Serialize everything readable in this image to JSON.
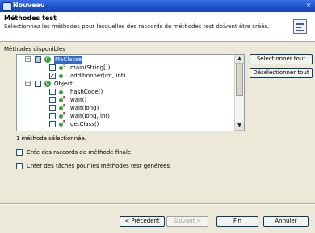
{
  "window": {
    "title": "Nouveau",
    "close_glyph": "×"
  },
  "header": {
    "title": "Méthodes test",
    "description": "Sélectionnez les méthodes pour lesquelles des raccords de méthodes test doivent être créés.",
    "icon": "wizard-page-icon"
  },
  "tree": {
    "label": "Méthodes disponibles",
    "rows": [
      {
        "label": "MaClasse",
        "checked": "partial",
        "selected": true,
        "icon": "class-icon"
      },
      {
        "label": "main(String[])",
        "checked": false,
        "icon": "method-icon",
        "modifier": "static"
      },
      {
        "label": "additionner(int, int)",
        "checked": true,
        "icon": "method-icon"
      },
      {
        "label": "Object",
        "checked": false,
        "icon": "class-icon"
      },
      {
        "label": "hashCode()",
        "checked": false,
        "icon": "method-icon"
      },
      {
        "label": "wait()",
        "checked": false,
        "icon": "method-icon",
        "modifier": "final"
      },
      {
        "label": "wait(long)",
        "checked": false,
        "icon": "method-icon",
        "modifier": "final"
      },
      {
        "label": "wait(long, int)",
        "checked": false,
        "icon": "method-icon",
        "modifier": "final"
      },
      {
        "label": "getClass()",
        "checked": false,
        "icon": "method-icon",
        "modifier": "final"
      }
    ]
  },
  "buttons": {
    "select_all": "Sélectionner tout",
    "deselect_all": "Désélectionner tout",
    "previous": "< Précédent",
    "next": "Suivant >",
    "finish": "Fin",
    "cancel": "Annuler"
  },
  "status": "1 méthode sélectionnée.",
  "options": {
    "final_stubs": "Crée des raccords de méthode finale",
    "tasks": "Créer des tâches pour les méthodes test générées"
  }
}
